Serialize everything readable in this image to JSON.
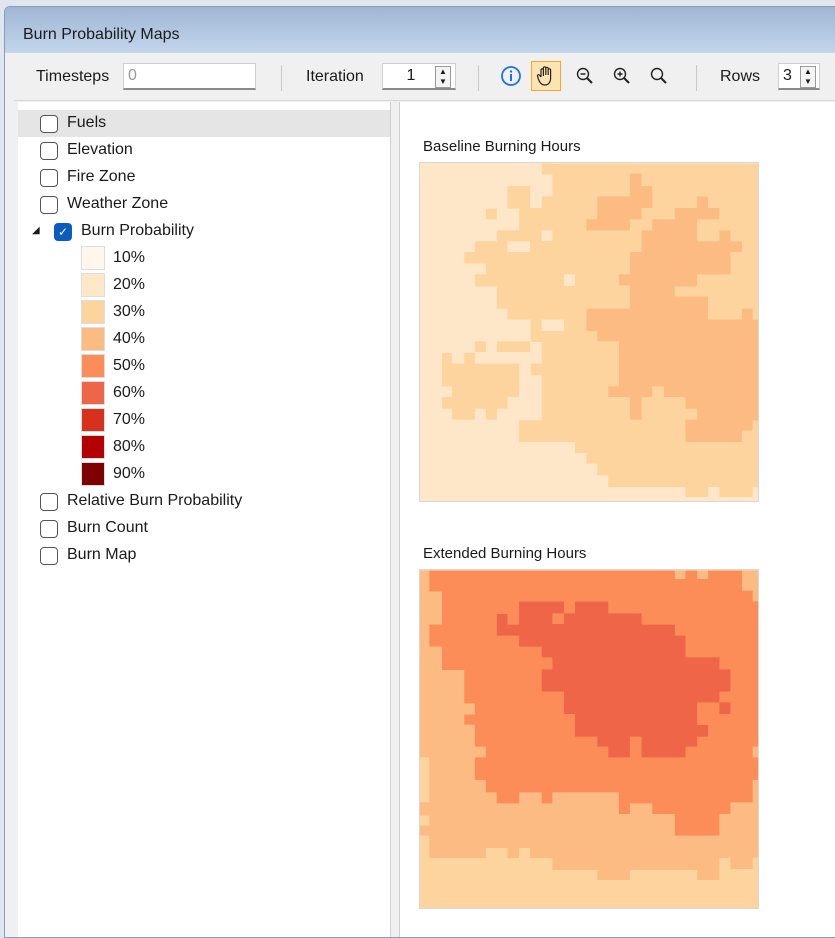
{
  "window": {
    "title": "Burn Probability Maps"
  },
  "toolbar": {
    "timesteps_label": "Timesteps",
    "timesteps_value": "0",
    "iteration_label": "Iteration",
    "iteration_value": "1",
    "tools": [
      "info-icon",
      "pan-hand-icon",
      "zoom-out-icon",
      "zoom-in-icon",
      "zoom-icon"
    ],
    "active_tool": "pan-hand-icon",
    "rows_label": "Rows",
    "rows_value": "3"
  },
  "layers": [
    {
      "label": "Fuels",
      "checked": false,
      "selected": true
    },
    {
      "label": "Elevation",
      "checked": false
    },
    {
      "label": "Fire Zone",
      "checked": false
    },
    {
      "label": "Weather Zone",
      "checked": false
    },
    {
      "label": "Burn Probability",
      "checked": true,
      "expanded": true
    },
    {
      "label": "Relative Burn Probability",
      "checked": false
    },
    {
      "label": "Burn Count",
      "checked": false
    },
    {
      "label": "Burn Map",
      "checked": false
    }
  ],
  "legend": [
    {
      "label": "10%",
      "color": "#fff7ec"
    },
    {
      "label": "20%",
      "color": "#fee8c8"
    },
    {
      "label": "30%",
      "color": "#fdd49e"
    },
    {
      "label": "40%",
      "color": "#fdbb84"
    },
    {
      "label": "50%",
      "color": "#fc8d59"
    },
    {
      "label": "60%",
      "color": "#ef6548"
    },
    {
      "label": "70%",
      "color": "#d7301f"
    },
    {
      "label": "80%",
      "color": "#b30000"
    },
    {
      "label": "90%",
      "color": "#7f0000"
    }
  ],
  "maps": [
    {
      "title": "Baseline Burning Hours"
    },
    {
      "title": "Extended Burning Hours"
    }
  ]
}
